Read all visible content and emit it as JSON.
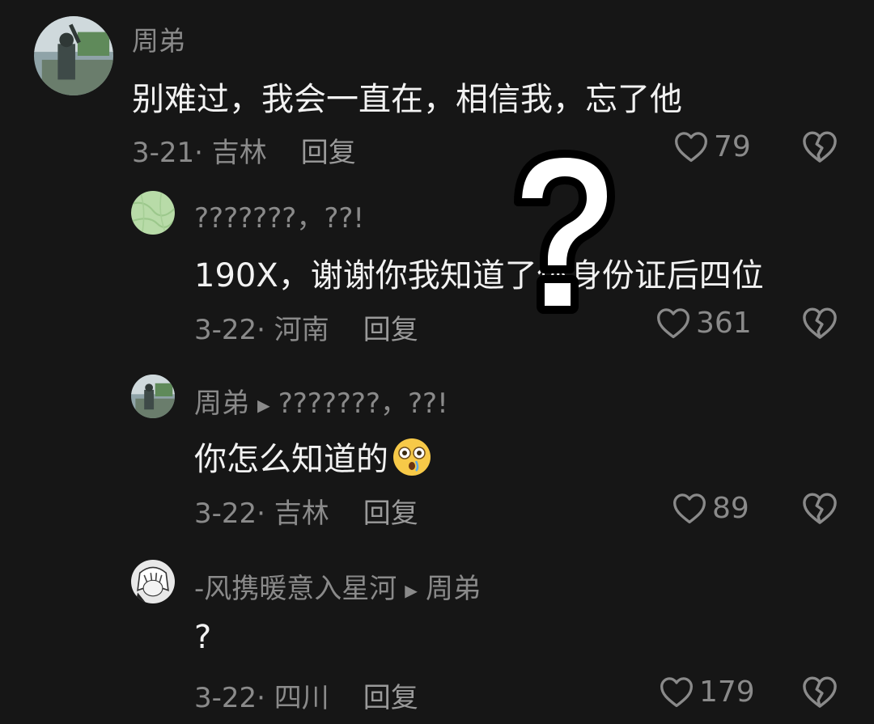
{
  "comments": [
    {
      "username": "周弟",
      "reply_to": "",
      "text": "别难过，我会一直在，相信我，忘了他",
      "date_location": "3-21· 吉林",
      "reply_label": "回复",
      "likes": "79"
    },
    {
      "username": "???????，??!",
      "reply_to": "",
      "text": "190X，谢谢你我知道了你身份证后四位",
      "date_location": "3-22· 河南",
      "reply_label": "回复",
      "likes": "361"
    },
    {
      "username": "周弟",
      "reply_to": "???????，??!",
      "text": "你怎么知道的",
      "date_location": "3-22· 吉林",
      "reply_label": "回复",
      "likes": "89"
    },
    {
      "username": "-风携暖意入星河",
      "reply_to": "周弟",
      "text": "?",
      "date_location": "3-22· 四川",
      "reply_label": "回复",
      "likes": "179"
    }
  ],
  "icons": {
    "like": "heart-outline-icon",
    "dislike": "broken-heart-icon",
    "emoji": "astonished-face-emoji",
    "overlay": "question-mark-overlay"
  },
  "colors": {
    "background": "#161616",
    "secondary_text": "#8a8a8a",
    "primary_text": "#f2f2f2"
  }
}
